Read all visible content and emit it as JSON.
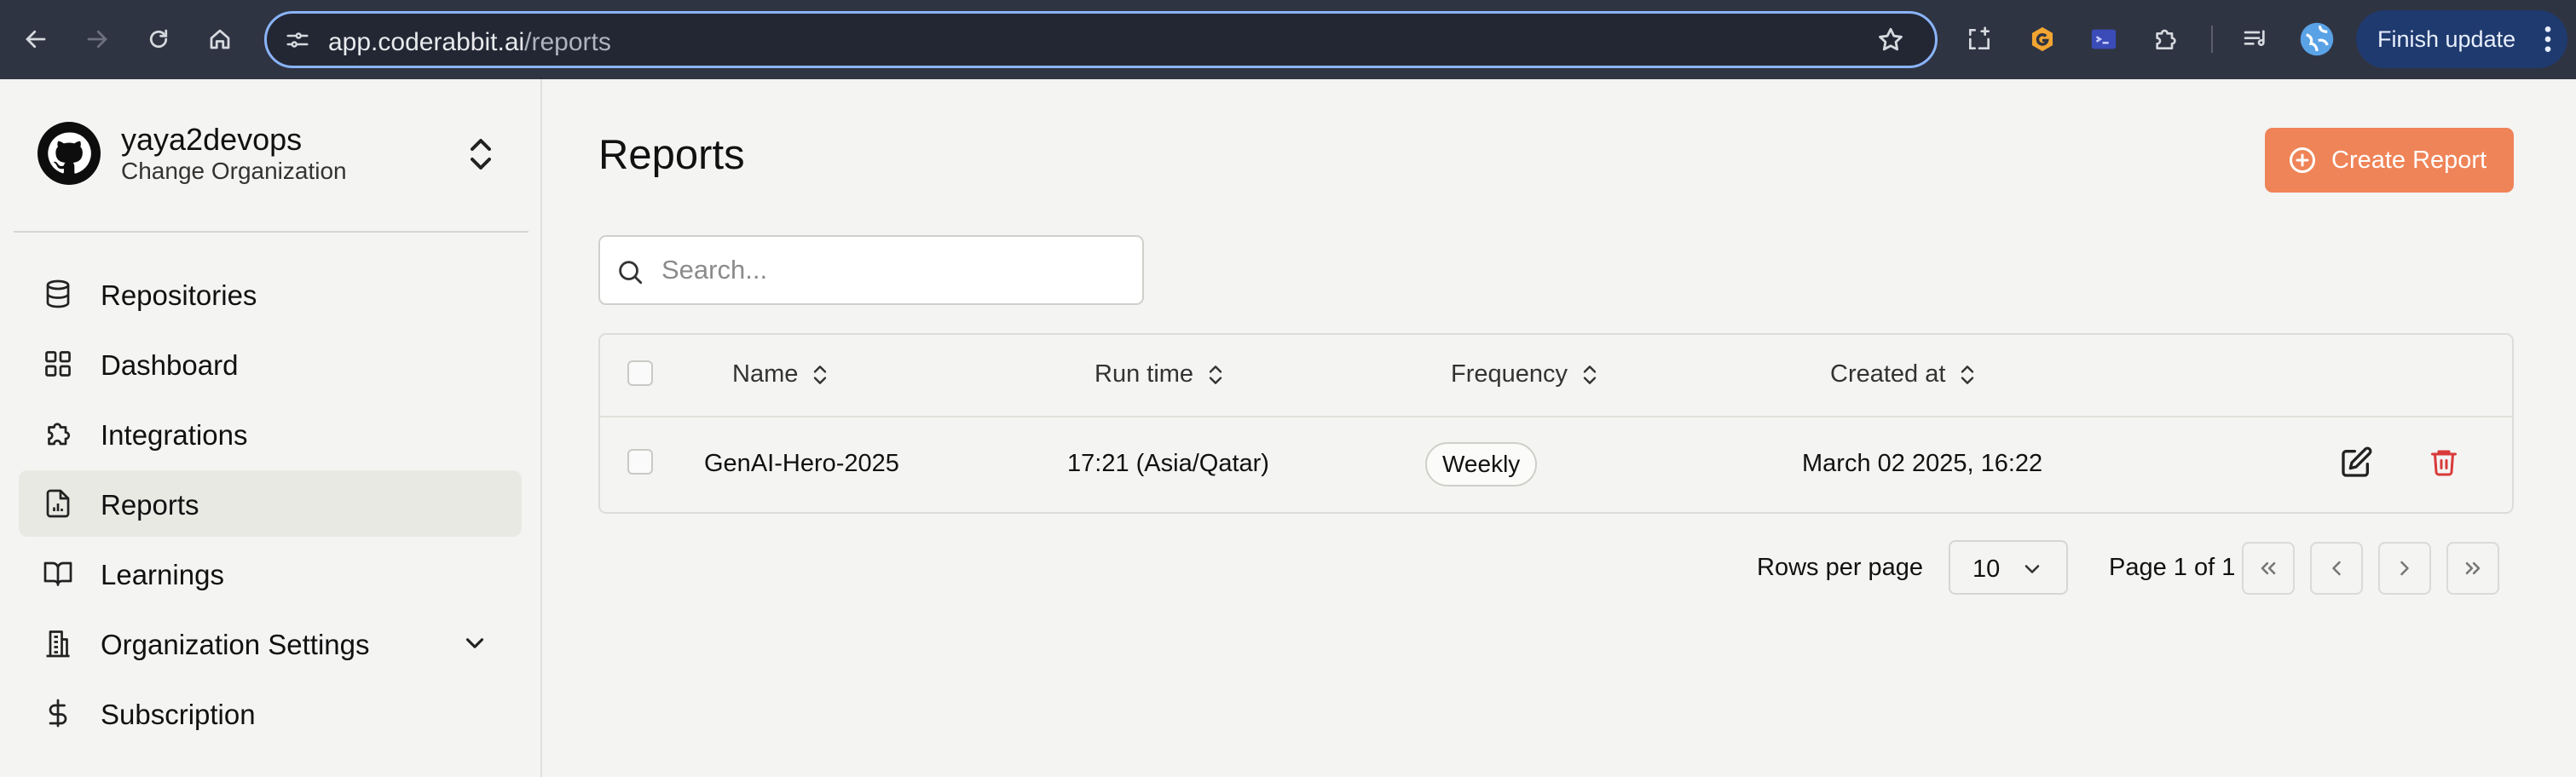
{
  "browser": {
    "url_host": "app.coderabbit.ai",
    "url_path": "/reports",
    "finish_update_label": "Finish update",
    "icons": [
      "back-icon",
      "forward-icon",
      "reload-icon",
      "home-icon",
      "site-info-icon",
      "bookmark-star-icon",
      "screenshot-icon",
      "extension-orange-icon",
      "extension-terminal-icon",
      "extensions-puzzle-icon",
      "reading-list-icon",
      "profile-avatar-icon",
      "more-menu-icon"
    ]
  },
  "sidebar": {
    "org_name": "yaya2devops",
    "org_subtitle": "Change Organization",
    "items": [
      {
        "label": "Repositories",
        "icon": "database-icon"
      },
      {
        "label": "Dashboard",
        "icon": "dashboard-grid-icon"
      },
      {
        "label": "Integrations",
        "icon": "puzzle-icon"
      },
      {
        "label": "Reports",
        "icon": "report-file-icon",
        "active": true
      },
      {
        "label": "Learnings",
        "icon": "book-open-icon"
      },
      {
        "label": "Organization Settings",
        "icon": "building-icon",
        "expandable": true
      },
      {
        "label": "Subscription",
        "icon": "dollar-icon"
      }
    ]
  },
  "main": {
    "title": "Reports",
    "create_button_label": "Create Report",
    "search_placeholder": "Search...",
    "table": {
      "columns": [
        "Name",
        "Run time",
        "Frequency",
        "Created at"
      ],
      "rows": [
        {
          "name": "GenAI-Hero-2025",
          "run_time": "17:21 (Asia/Qatar)",
          "frequency": "Weekly",
          "created_at": "March 02 2025, 16:22"
        }
      ]
    },
    "pagination": {
      "rows_per_page_label": "Rows per page",
      "rows_per_page_value": "10",
      "page_info": "Page 1 of 1"
    }
  },
  "colors": {
    "accent": "#ef8458",
    "chrome": "#2f3443",
    "delete": "#d93a3a"
  }
}
